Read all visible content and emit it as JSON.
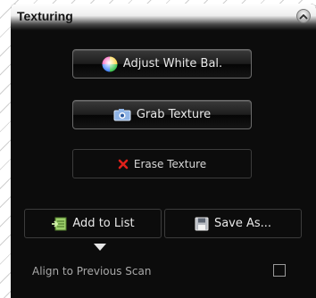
{
  "panel": {
    "title": "Texturing",
    "collapse_icon": "chevron-up-icon"
  },
  "buttons": {
    "adjust_white_balance": {
      "label": "Adjust White Bal.",
      "icon": "color-wheel-icon"
    },
    "grab_texture": {
      "label": "Grab Texture",
      "icon": "camera-icon"
    },
    "erase_texture": {
      "label": "Erase Texture",
      "icon": "red-x-icon"
    },
    "add_to_list": {
      "label": "Add to List",
      "icon": "add-to-list-icon"
    },
    "save_as": {
      "label": "Save As...",
      "icon": "floppy-disk-icon"
    }
  },
  "options": {
    "align_label": "Align to Previous Scan",
    "align_checked": false
  },
  "colors": {
    "panel_background": "#0c0c0c",
    "erase_icon": "#e0201a",
    "button_text": "#e8e8e8",
    "option_text": "#a8a8a8"
  }
}
